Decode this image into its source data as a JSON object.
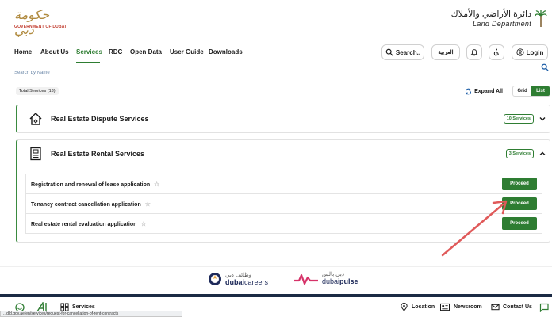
{
  "header": {
    "gov_logo_arabic": "حكومة دبي",
    "gov_logo_en": "GOVERNMENT OF DUBAI",
    "dld_logo_arabic": "دائرة الأراضي والأملاك",
    "dld_logo_en": "Land Department"
  },
  "nav": {
    "items": [
      "Home",
      "About Us",
      "Services",
      "RDC",
      "Open Data",
      "User Guide",
      "Downloads"
    ],
    "active": "Services",
    "search_label": "Search..",
    "language_label": "العربية",
    "login_label": "Login"
  },
  "search": {
    "placeholder": "Search by Name"
  },
  "summary": {
    "total_label": "Total Services (13)",
    "expand_all_label": "Expand All",
    "view_grid": "Grid",
    "view_list": "List"
  },
  "categories": [
    {
      "title": "Real Estate Dispute Services",
      "count_label": "10 Services",
      "expanded": false
    },
    {
      "title": "Real Estate Rental Services",
      "count_label": "3 Services",
      "expanded": true
    }
  ],
  "rental_services": [
    {
      "name": "Registration and renewal of lease application",
      "action": "Proceed"
    },
    {
      "name": "Tenancy contract cancellation application",
      "action": "Proceed"
    },
    {
      "name": "Real estate rental evaluation application",
      "action": "Proceed"
    }
  ],
  "partners": {
    "careers_ar": "وظائف دبي",
    "careers_en_bold": "dubai",
    "careers_en_light": "careers",
    "pulse_ar": "دبي بالس",
    "pulse_en_light": "dubai",
    "pulse_en_bold": "pulse"
  },
  "footer": {
    "services_label": "Services",
    "location_label": "Location",
    "newsroom_label": "Newsroom",
    "contact_label": "Contact Us"
  },
  "status_bar_url": "...dld.gov.ae/en/services/request-for-cancellation-of-rent-contracts"
}
